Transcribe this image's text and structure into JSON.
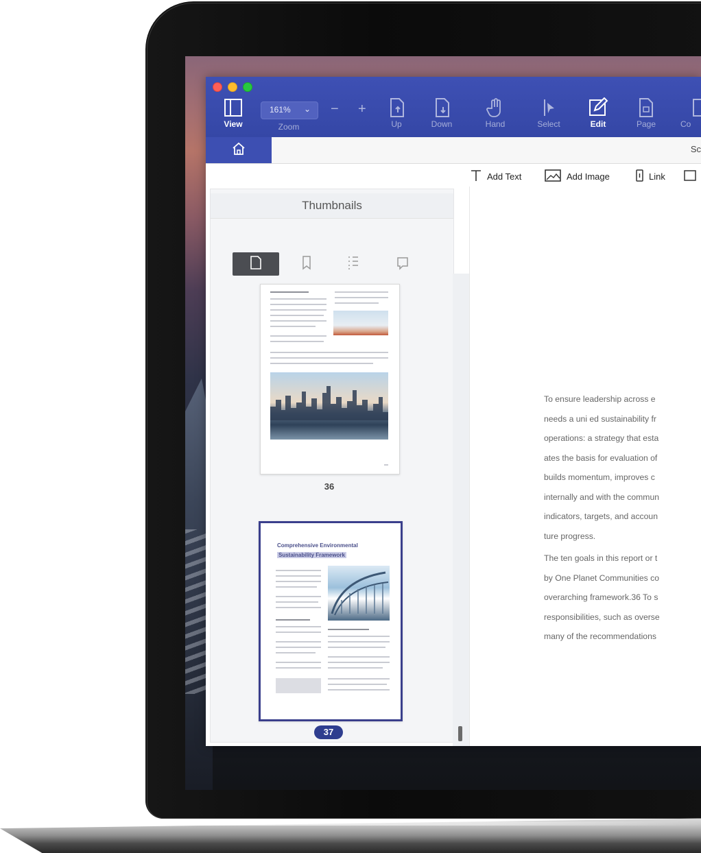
{
  "toolbar": {
    "zoom_value": "161%",
    "zoom_label": "Zoom",
    "zoom_minus": "−",
    "zoom_plus": "+",
    "view_label": "View",
    "up_label": "Up",
    "down_label": "Down",
    "hand_label": "Hand",
    "select_label": "Select",
    "edit_label": "Edit",
    "page_label": "Page",
    "convert_label": "Co"
  },
  "tabs": {
    "right_text": "Sc"
  },
  "edit_toolbar": {
    "add_text": "Add Text",
    "add_image": "Add Image",
    "link": "Link"
  },
  "sidebar": {
    "title": "Thumbnails",
    "pages": [
      {
        "number": "36"
      },
      {
        "number": "37",
        "heading_line1": "Comprehensive Environmental",
        "heading_line2": "Sustainability Framework",
        "selected": true
      }
    ]
  },
  "document": {
    "paragraph1": [
      "To ensure leadership across e",
      "needs a uni ed sustainability fr",
      "operations: a strategy that esta",
      "ates the basis for evaluation of",
      "builds momentum, improves c",
      "internally and with the commun",
      "indicators, targets, and accoun",
      "ture progress."
    ],
    "paragraph2": [
      "The ten goals in this report or t",
      "by One Planet Communities co",
      "overarching framework.36 To s",
      "responsibilities, such as overse",
      "many of the recommendations"
    ]
  },
  "colors": {
    "toolbar": "#3e50b4",
    "home_tab": "#3d4fb2",
    "page_badge": "#2f3e8f",
    "selection_border": "#3a3f8c"
  }
}
